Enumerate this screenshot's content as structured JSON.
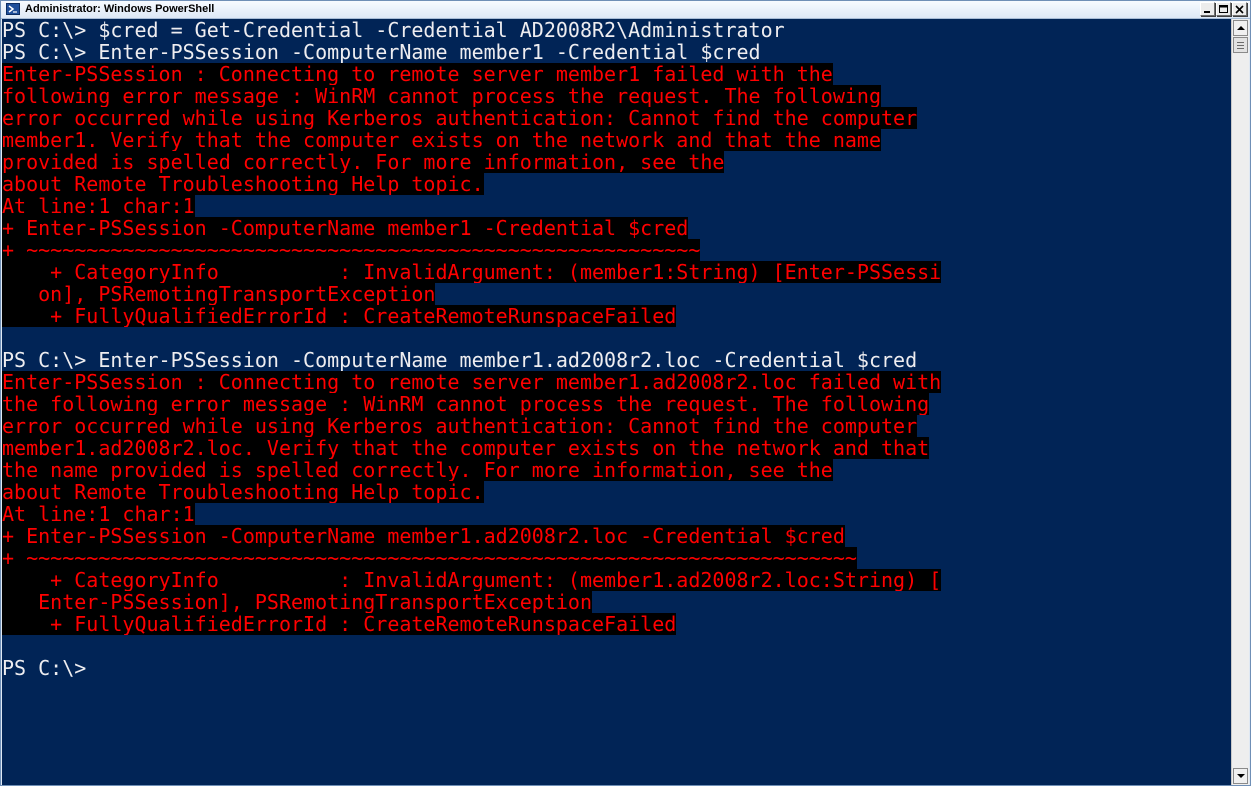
{
  "window": {
    "title": "Administrator: Windows PowerShell",
    "icon": "powershell-icon",
    "buttons": [
      "minimize-icon",
      "maximize-icon",
      "close-icon"
    ]
  },
  "colors": {
    "console_background": "#012456",
    "output_text": "#eeedf0",
    "error_text": "#ff0000",
    "error_background": "#000000"
  },
  "console": {
    "lines": [
      {
        "kind": "out",
        "text": "PS C:\\> $cred = Get-Credential -Credential AD2008R2\\Administrator"
      },
      {
        "kind": "out",
        "text": "PS C:\\> Enter-PSSession -ComputerName member1 -Credential $cred"
      },
      {
        "kind": "err",
        "text": "Enter-PSSession : Connecting to remote server member1 failed with the"
      },
      {
        "kind": "err",
        "text": "following error message : WinRM cannot process the request. The following"
      },
      {
        "kind": "err",
        "text": "error occurred while using Kerberos authentication: Cannot find the computer"
      },
      {
        "kind": "err",
        "text": "member1. Verify that the computer exists on the network and that the name"
      },
      {
        "kind": "err",
        "text": "provided is spelled correctly. For more information, see the"
      },
      {
        "kind": "err",
        "text": "about_Remote_Troubleshooting Help topic."
      },
      {
        "kind": "err",
        "text": "At line:1 char:1"
      },
      {
        "kind": "err",
        "text": "+ Enter-PSSession -ComputerName member1 -Credential $cred"
      },
      {
        "kind": "err",
        "text": "+ ~~~~~~~~~~~~~~~~~~~~~~~~~~~~~~~~~~~~~~~~~~~~~~~~~~~~~~~~"
      },
      {
        "kind": "err",
        "text": "    + CategoryInfo          : InvalidArgument: (member1:String) [Enter-PSSessi"
      },
      {
        "kind": "err",
        "text": "   on], PSRemotingTransportException"
      },
      {
        "kind": "err",
        "text": "    + FullyQualifiedErrorId : CreateRemoteRunspaceFailed"
      },
      {
        "kind": "out",
        "text": ""
      },
      {
        "kind": "out",
        "text": "PS C:\\> Enter-PSSession -ComputerName member1.ad2008r2.loc -Credential $cred"
      },
      {
        "kind": "err",
        "text": "Enter-PSSession : Connecting to remote server member1.ad2008r2.loc failed with"
      },
      {
        "kind": "err",
        "text": "the following error message : WinRM cannot process the request. The following"
      },
      {
        "kind": "err",
        "text": "error occurred while using Kerberos authentication: Cannot find the computer"
      },
      {
        "kind": "err",
        "text": "member1.ad2008r2.loc. Verify that the computer exists on the network and that"
      },
      {
        "kind": "err",
        "text": "the name provided is spelled correctly. For more information, see the"
      },
      {
        "kind": "err",
        "text": "about_Remote_Troubleshooting Help topic."
      },
      {
        "kind": "err",
        "text": "At line:1 char:1"
      },
      {
        "kind": "err",
        "text": "+ Enter-PSSession -ComputerName member1.ad2008r2.loc -Credential $cred"
      },
      {
        "kind": "err",
        "text": "+ ~~~~~~~~~~~~~~~~~~~~~~~~~~~~~~~~~~~~~~~~~~~~~~~~~~~~~~~~~~~~~~~~~~~~~"
      },
      {
        "kind": "err",
        "text": "    + CategoryInfo          : InvalidArgument: (member1.ad2008r2.loc:String) ["
      },
      {
        "kind": "err",
        "text": "   Enter-PSSession], PSRemotingTransportException"
      },
      {
        "kind": "err",
        "text": "    + FullyQualifiedErrorId : CreateRemoteRunspaceFailed"
      },
      {
        "kind": "out",
        "text": ""
      },
      {
        "kind": "out",
        "text": "PS C:\\>"
      }
    ]
  }
}
